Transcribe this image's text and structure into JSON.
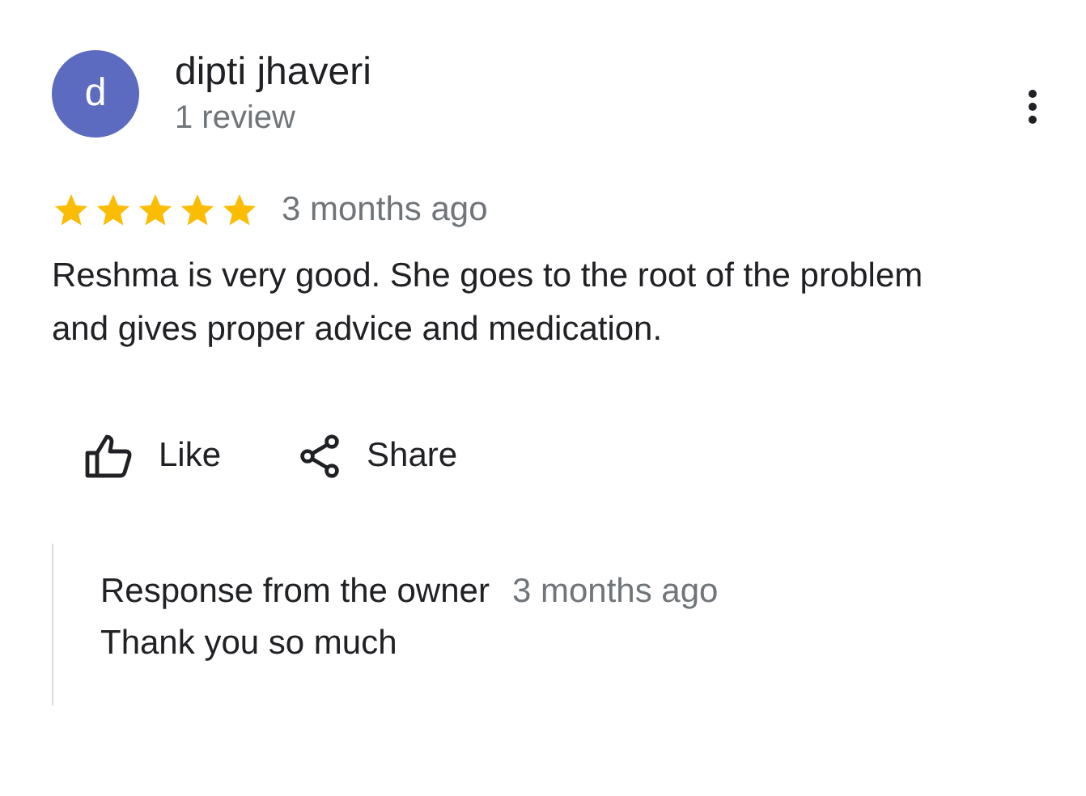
{
  "reviewer": {
    "initial": "d",
    "name": "dipti jhaveri",
    "meta": "1 review"
  },
  "review": {
    "stars": 5,
    "time": "3 months ago",
    "text": "Reshma is very good. She goes to the root of the problem and gives proper advice and medication."
  },
  "actions": [
    {
      "kind": "like",
      "label": "Like"
    },
    {
      "kind": "share",
      "label": "Share"
    }
  ],
  "owner_response": {
    "title": "Response from the owner",
    "time": "3 months ago",
    "text": "Thank you so much"
  }
}
